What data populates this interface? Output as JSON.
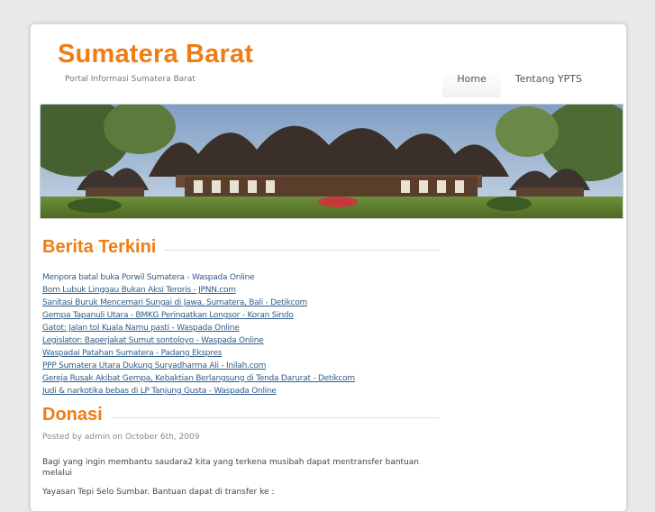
{
  "header": {
    "site_title": "Sumatera Barat",
    "tagline": "Portal Informasi Sumatera Barat"
  },
  "nav": {
    "items": [
      {
        "label": "Home"
      },
      {
        "label": "Tentang YPTS"
      }
    ]
  },
  "banner": {
    "icon": "rumah-gadang-photo"
  },
  "news": {
    "title": "Berita Terkini",
    "items": [
      "Menpora batal buka Porwil Sumatera - Waspada Online",
      "Bom Lubuk Linggau Bukan Aksi Teroris - JPNN.com",
      "Sanitasi Buruk Mencemari Sungai di Jawa, Sumatera, Bali - Detikcom",
      "Gempa Tapanuli Utara - BMKG Peringatkan Longsor - Koran Sindo",
      "Gatot: Jalan tol Kuala Namu pasti - Waspada Online",
      "Legislator: Baperjakat Sumut sontoloyo - Waspada Online",
      "Waspadai Patahan Sumatera - Padang Ekspres",
      "PPP Sumatera Utara Dukung Suryadharma Ali - Inilah.com",
      "Gereja Rusak Akibat Gempa, Kebaktian Berlangsung di Tenda Darurat - Detikcom",
      "Judi & narkotika bebas di LP Tanjung Gusta - Waspada Online"
    ]
  },
  "post": {
    "title": "Donasi",
    "meta": "Posted by admin on October 6th, 2009",
    "paragraph1": "Bagi yang ingin membantu saudara2 kita yang terkena musibah dapat mentransfer bantuan melalui",
    "paragraph2": "Yayasan Tepi Selo Sumbar. Bantuan dapat di transfer ke :"
  },
  "colors": {
    "accent": "#f07c14",
    "link": "#2f5d8a",
    "background": "#e9e9e9"
  }
}
